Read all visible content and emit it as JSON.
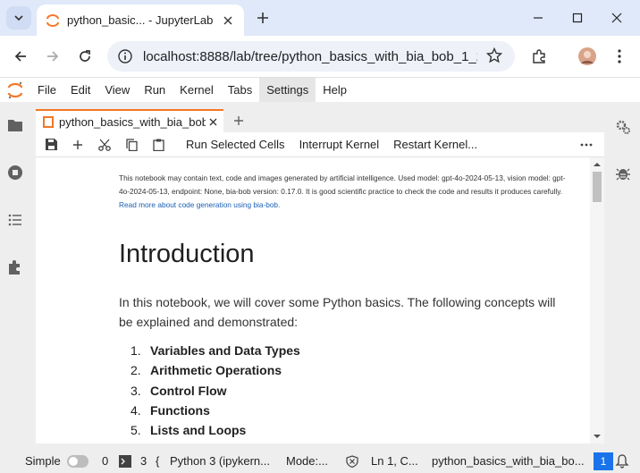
{
  "browser": {
    "tab_title": "python_basic... - JupyterLab",
    "url": "localhost:8888/lab/tree/python_basics_with_bia_bob_1_2.ip..."
  },
  "menubar": {
    "items": [
      "File",
      "Edit",
      "View",
      "Run",
      "Kernel",
      "Tabs",
      "Settings",
      "Help"
    ],
    "active": "Settings"
  },
  "doc": {
    "tab_label": "python_basics_with_bia_bob_"
  },
  "toolbar": {
    "run_selected": "Run Selected Cells",
    "interrupt": "Interrupt Kernel",
    "restart": "Restart Kernel..."
  },
  "notebook": {
    "disclaimer_text": "This notebook may contain text, code and images generated by artificial intelligence. Used model: gpt-4o-2024-05-13, vision model: gpt-4o-2024-05-13, endpoint: None, bia-bob version: 0.17.0. It is good scientific practice to check the code and results it produces carefully.",
    "disclaimer_link": "Read more about code generation using bia-bob.",
    "heading": "Introduction",
    "paragraph": "In this notebook, we will cover some Python basics. The following concepts will be explained and demonstrated:",
    "list": [
      {
        "num": "1.",
        "text": "Variables and Data Types"
      },
      {
        "num": "2.",
        "text": "Arithmetic Operations"
      },
      {
        "num": "3.",
        "text": "Control Flow"
      },
      {
        "num": "4.",
        "text": "Functions"
      },
      {
        "num": "5.",
        "text": "Lists and Loops"
      }
    ]
  },
  "statusbar": {
    "simple_label": "Simple",
    "count0": "0",
    "count3": "3",
    "kernel": "Python 3 (ipykern...",
    "mode": "Mode:...",
    "position": "Ln 1, C...",
    "filename": "python_basics_with_bia_bo...",
    "notifications": "1"
  },
  "colors": {
    "jupyter_orange": "#f37726",
    "link_blue": "#1a5fb4",
    "chrome_tab_bg": "#dfe9f9"
  }
}
